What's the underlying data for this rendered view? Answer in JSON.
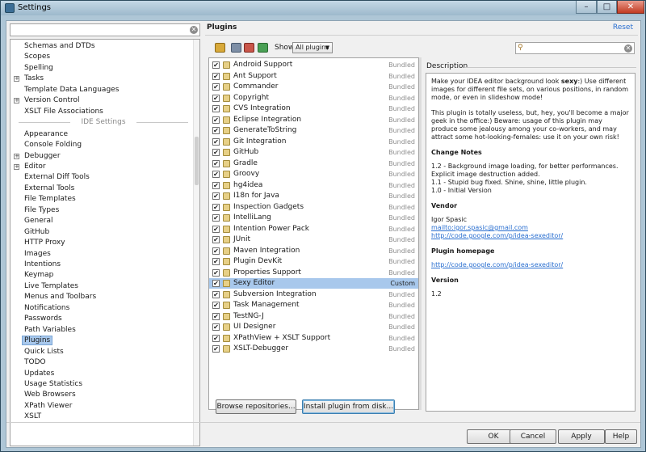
{
  "window": {
    "title": "Settings",
    "min_glyph": "–",
    "max_glyph": "□",
    "close_glyph": "✕"
  },
  "left": {
    "search_value": "",
    "clear_glyph": "✕",
    "items_top": [
      {
        "label": "Schemas and DTDs",
        "expandable": false
      },
      {
        "label": "Scopes",
        "expandable": false
      },
      {
        "label": "Spelling",
        "expandable": false
      },
      {
        "label": "Tasks",
        "expandable": true
      },
      {
        "label": "Template Data Languages",
        "expandable": false
      },
      {
        "label": "Version Control",
        "expandable": true
      },
      {
        "label": "XSLT File Associations",
        "expandable": false
      }
    ],
    "section_label": "IDE Settings",
    "items_ide": [
      {
        "label": "Appearance",
        "expandable": false
      },
      {
        "label": "Console Folding",
        "expandable": false
      },
      {
        "label": "Debugger",
        "expandable": true
      },
      {
        "label": "Editor",
        "expandable": true
      },
      {
        "label": "External Diff Tools",
        "expandable": false
      },
      {
        "label": "External Tools",
        "expandable": false
      },
      {
        "label": "File Templates",
        "expandable": false
      },
      {
        "label": "File Types",
        "expandable": false
      },
      {
        "label": "General",
        "expandable": false
      },
      {
        "label": "GitHub",
        "expandable": false
      },
      {
        "label": "HTTP Proxy",
        "expandable": false
      },
      {
        "label": "Images",
        "expandable": false
      },
      {
        "label": "Intentions",
        "expandable": false
      },
      {
        "label": "Keymap",
        "expandable": false
      },
      {
        "label": "Live Templates",
        "expandable": false
      },
      {
        "label": "Menus and Toolbars",
        "expandable": false
      },
      {
        "label": "Notifications",
        "expandable": false
      },
      {
        "label": "Passwords",
        "expandable": false
      },
      {
        "label": "Path Variables",
        "expandable": false
      },
      {
        "label": "Plugins",
        "expandable": false,
        "selected": true
      },
      {
        "label": "Quick Lists",
        "expandable": false
      },
      {
        "label": "TODO",
        "expandable": false
      },
      {
        "label": "Updates",
        "expandable": false
      },
      {
        "label": "Usage Statistics",
        "expandable": false
      },
      {
        "label": "Web Browsers",
        "expandable": false
      },
      {
        "label": "XPath Viewer",
        "expandable": false
      },
      {
        "label": "XSLT",
        "expandable": false
      }
    ]
  },
  "main": {
    "title": "Plugins",
    "reset": "Reset",
    "toolbar": {
      "show_label": "Show:",
      "show_value": "All plugins",
      "show_arrow": "▼"
    },
    "search_value": "",
    "search_glyph": "⚲",
    "clear_glyph": "✕",
    "check_glyph": "✔",
    "plugins": [
      {
        "name": "Android Support",
        "status": "Bundled",
        "checked": true
      },
      {
        "name": "Ant Support",
        "status": "Bundled",
        "checked": true
      },
      {
        "name": "Commander",
        "status": "Bundled",
        "checked": true
      },
      {
        "name": "Copyright",
        "status": "Bundled",
        "checked": true
      },
      {
        "name": "CVS Integration",
        "status": "Bundled",
        "checked": true
      },
      {
        "name": "Eclipse Integration",
        "status": "Bundled",
        "checked": true
      },
      {
        "name": "GenerateToString",
        "status": "Bundled",
        "checked": true
      },
      {
        "name": "Git Integration",
        "status": "Bundled",
        "checked": true
      },
      {
        "name": "GitHub",
        "status": "Bundled",
        "checked": true
      },
      {
        "name": "Gradle",
        "status": "Bundled",
        "checked": true
      },
      {
        "name": "Groovy",
        "status": "Bundled",
        "checked": true
      },
      {
        "name": "hg4idea",
        "status": "Bundled",
        "checked": true
      },
      {
        "name": "I18n for Java",
        "status": "Bundled",
        "checked": true
      },
      {
        "name": "Inspection Gadgets",
        "status": "Bundled",
        "checked": true
      },
      {
        "name": "IntelliLang",
        "status": "Bundled",
        "checked": true
      },
      {
        "name": "Intention Power Pack",
        "status": "Bundled",
        "checked": true
      },
      {
        "name": "JUnit",
        "status": "Bundled",
        "checked": true
      },
      {
        "name": "Maven Integration",
        "status": "Bundled",
        "checked": true
      },
      {
        "name": "Plugin DevKit",
        "status": "Bundled",
        "checked": true
      },
      {
        "name": "Properties Support",
        "status": "Bundled",
        "checked": true
      },
      {
        "name": "Sexy Editor",
        "status": "Custom",
        "checked": true,
        "selected": true
      },
      {
        "name": "Subversion Integration",
        "status": "Bundled",
        "checked": true
      },
      {
        "name": "Task Management",
        "status": "Bundled",
        "checked": true
      },
      {
        "name": "TestNG-J",
        "status": "Bundled",
        "checked": true
      },
      {
        "name": "UI Designer",
        "status": "Bundled",
        "checked": true
      },
      {
        "name": "XPathView + XSLT Support",
        "status": "Bundled",
        "checked": true
      },
      {
        "name": "XSLT-Debugger",
        "status": "Bundled",
        "checked": true
      }
    ],
    "description": {
      "label": "Description",
      "intro_pre": "Make your IDEA editor background look ",
      "intro_bold": "sexy",
      "intro_post": ":) Use different images for different file sets, on various positions, in random mode, or even in slideshow mode!",
      "para2": "This plugin is totally useless, but, hey, you'll become a major geek in the office:) Beware: usage of this plugin may produce some jealousy among your co-workers, and may attract some hot-looking-females: use it on your own risk!",
      "change_notes_title": "Change Notes",
      "change_notes": [
        "1.2 - Background image loading, for better performances. Explicit image destruction added.",
        "1.1 - Stupid bug fixed. Shine, shine, little plugin.",
        "1.0 - Initial Version"
      ],
      "vendor_title": "Vendor",
      "vendor_name": "Igor Spasic",
      "vendor_email": "mailto:igor.spasic@gmail.com",
      "vendor_url": "http://code.google.com/p/idea-sexeditor/",
      "homepage_title": "Plugin homepage",
      "homepage_url": "http://code.google.com/p/idea-sexeditor/",
      "version_title": "Version",
      "version": "1.2"
    },
    "browse_button": "Browse repositories...",
    "install_button": "Install plugin from disk..."
  },
  "footer": {
    "ok": "OK",
    "cancel": "Cancel",
    "apply": "Apply",
    "help": "Help"
  }
}
